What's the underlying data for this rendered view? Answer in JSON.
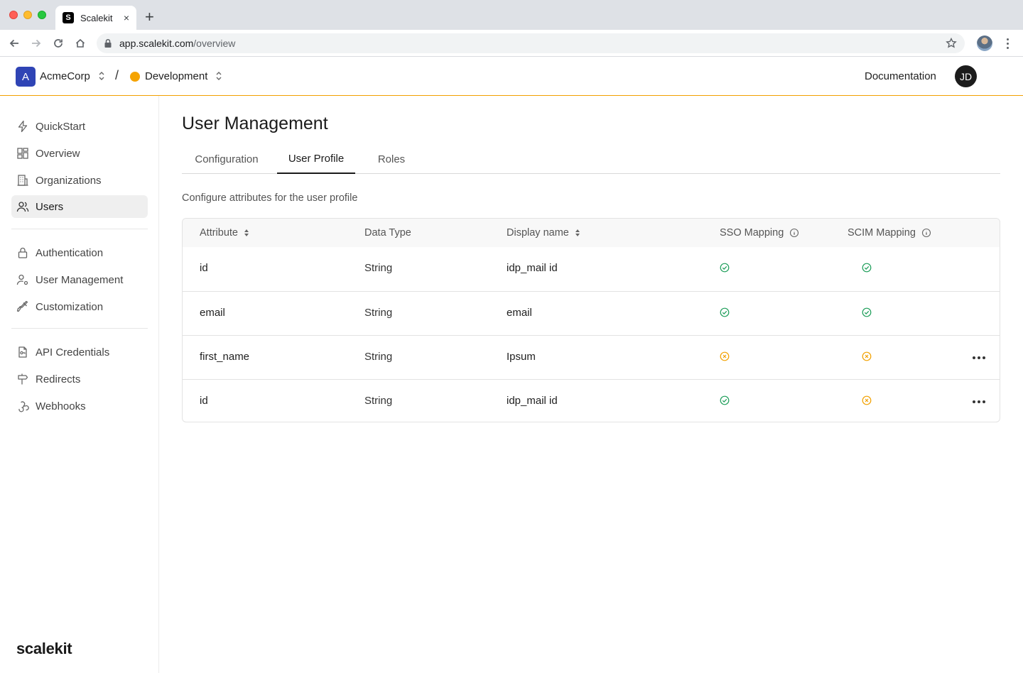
{
  "browser": {
    "tab_title": "Scalekit",
    "tab_favicon": "S",
    "url_host": "app.scalekit.com",
    "url_path": "/overview",
    "new_tab": "+",
    "tab_close": "×"
  },
  "header": {
    "org_initial": "A",
    "org_name": "AcmeCorp",
    "separator": "/",
    "env_name": "Development",
    "env_color": "#f5a300",
    "docs_label": "Documentation",
    "user_initials": "JD",
    "accent_border": "#f2a100"
  },
  "sidebar": {
    "groups": [
      [
        {
          "label": "QuickStart",
          "icon": "bolt-icon"
        },
        {
          "label": "Overview",
          "icon": "dashboard-icon"
        },
        {
          "label": "Organizations",
          "icon": "building-icon"
        },
        {
          "label": "Users",
          "icon": "users-icon",
          "active": true
        }
      ],
      [
        {
          "label": "Authentication",
          "icon": "lock-icon"
        },
        {
          "label": "User Management",
          "icon": "user-settings-icon"
        },
        {
          "label": "Customization",
          "icon": "brush-icon"
        }
      ],
      [
        {
          "label": "API Credentials",
          "icon": "key-doc-icon"
        },
        {
          "label": "Redirects",
          "icon": "signpost-icon"
        },
        {
          "label": "Webhooks",
          "icon": "webhook-icon"
        }
      ]
    ],
    "brand": "scalekit"
  },
  "main": {
    "title": "User Management",
    "tabs": [
      {
        "label": "Configuration",
        "active": false
      },
      {
        "label": "User Profile",
        "active": true
      },
      {
        "label": "Roles",
        "active": false
      }
    ],
    "subtitle": "Configure attributes for the user profile",
    "table": {
      "headers": {
        "attribute": "Attribute",
        "data_type": "Data Type",
        "display_name": "Display name",
        "sso": "SSO Mapping",
        "scim": "SCIM Mapping"
      },
      "rows": [
        {
          "attribute": "id",
          "data_type": "String",
          "display_name": "idp_mail id",
          "sso": "mapped",
          "scim": "mapped",
          "menu": false
        },
        {
          "attribute": "email",
          "data_type": "String",
          "display_name": "email",
          "sso": "mapped",
          "scim": "mapped",
          "menu": false
        },
        {
          "attribute": "first_name",
          "data_type": "String",
          "display_name": "Ipsum",
          "sso": "unmapped",
          "scim": "unmapped",
          "menu": true
        },
        {
          "attribute": "id",
          "data_type": "String",
          "display_name": "idp_mail id",
          "sso": "mapped",
          "scim": "unmapped",
          "menu": true
        }
      ],
      "status_colors": {
        "mapped": "#1e9e5a",
        "unmapped": "#f2a100"
      }
    }
  }
}
